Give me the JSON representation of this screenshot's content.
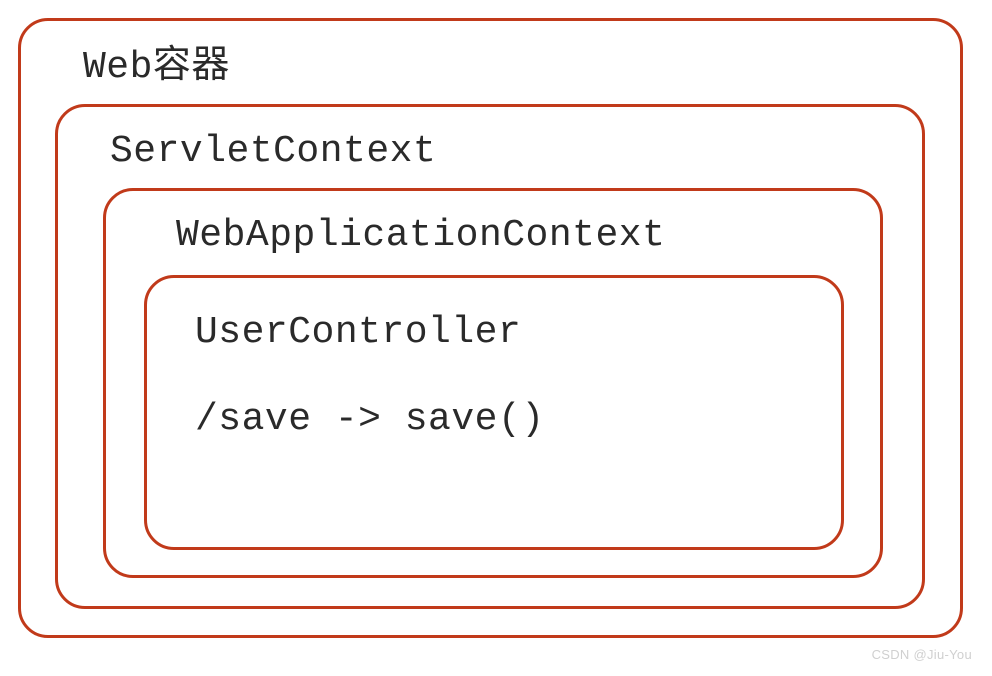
{
  "boxes": {
    "outer": {
      "label": "Web容器"
    },
    "servletContext": {
      "label": "ServletContext"
    },
    "webAppContext": {
      "label": "WebApplicationContext"
    },
    "userController": {
      "label": "UserController",
      "mapping": "/save -> save()"
    }
  },
  "watermark": "CSDN @Jiu-You",
  "colors": {
    "border": "#c13a1a",
    "text": "#2a2a2a"
  }
}
